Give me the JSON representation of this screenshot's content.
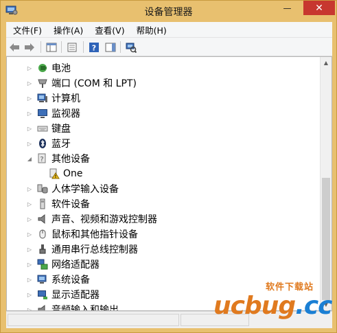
{
  "window": {
    "title": "设备管理器",
    "close_glyph": "✕",
    "min_glyph": "—",
    "max_glyph": "□"
  },
  "menu": [
    {
      "label": "文件(F)"
    },
    {
      "label": "操作(A)"
    },
    {
      "label": "查看(V)"
    },
    {
      "label": "帮助(H)"
    }
  ],
  "toolbar": [
    {
      "icon": "back-arrow-icon"
    },
    {
      "icon": "forward-arrow-icon"
    },
    {
      "icon": "show-hide-console-tree-icon"
    },
    {
      "icon": "properties-icon"
    },
    {
      "icon": "help-icon"
    },
    {
      "icon": "action-pane-icon"
    },
    {
      "icon": "scan-hardware-icon"
    }
  ],
  "tree": [
    {
      "label": "电池",
      "icon": "battery-icon",
      "expanded": false
    },
    {
      "label": "端口 (COM 和 LPT)",
      "icon": "port-icon",
      "expanded": false
    },
    {
      "label": "计算机",
      "icon": "computer-icon",
      "expanded": false
    },
    {
      "label": "监视器",
      "icon": "monitor-icon",
      "expanded": false
    },
    {
      "label": "键盘",
      "icon": "keyboard-icon",
      "expanded": false
    },
    {
      "label": "蓝牙",
      "icon": "bluetooth-icon",
      "expanded": false
    },
    {
      "label": "其他设备",
      "icon": "unknown-device-icon",
      "expanded": true
    },
    {
      "label": "One",
      "icon": "warning-device-icon",
      "child": true
    },
    {
      "label": "人体学输入设备",
      "icon": "hid-icon",
      "expanded": false
    },
    {
      "label": "软件设备",
      "icon": "software-device-icon",
      "expanded": false
    },
    {
      "label": "声音、视频和游戏控制器",
      "icon": "speaker-icon",
      "expanded": false
    },
    {
      "label": "鼠标和其他指针设备",
      "icon": "mouse-icon",
      "expanded": false
    },
    {
      "label": "通用串行总线控制器",
      "icon": "usb-icon",
      "expanded": false
    },
    {
      "label": "网络适配器",
      "icon": "network-adapter-icon",
      "expanded": false
    },
    {
      "label": "系统设备",
      "icon": "system-device-icon",
      "expanded": false
    },
    {
      "label": "显示适配器",
      "icon": "display-adapter-icon",
      "expanded": false
    },
    {
      "label": "音频输入和输出",
      "icon": "audio-io-icon",
      "expanded": false
    }
  ],
  "watermark": {
    "sub": "软件下载站",
    "main_a": "ucbug",
    "main_b": ".cc"
  },
  "colors": {
    "frame": "#e8c06f",
    "close": "#c7372f"
  }
}
